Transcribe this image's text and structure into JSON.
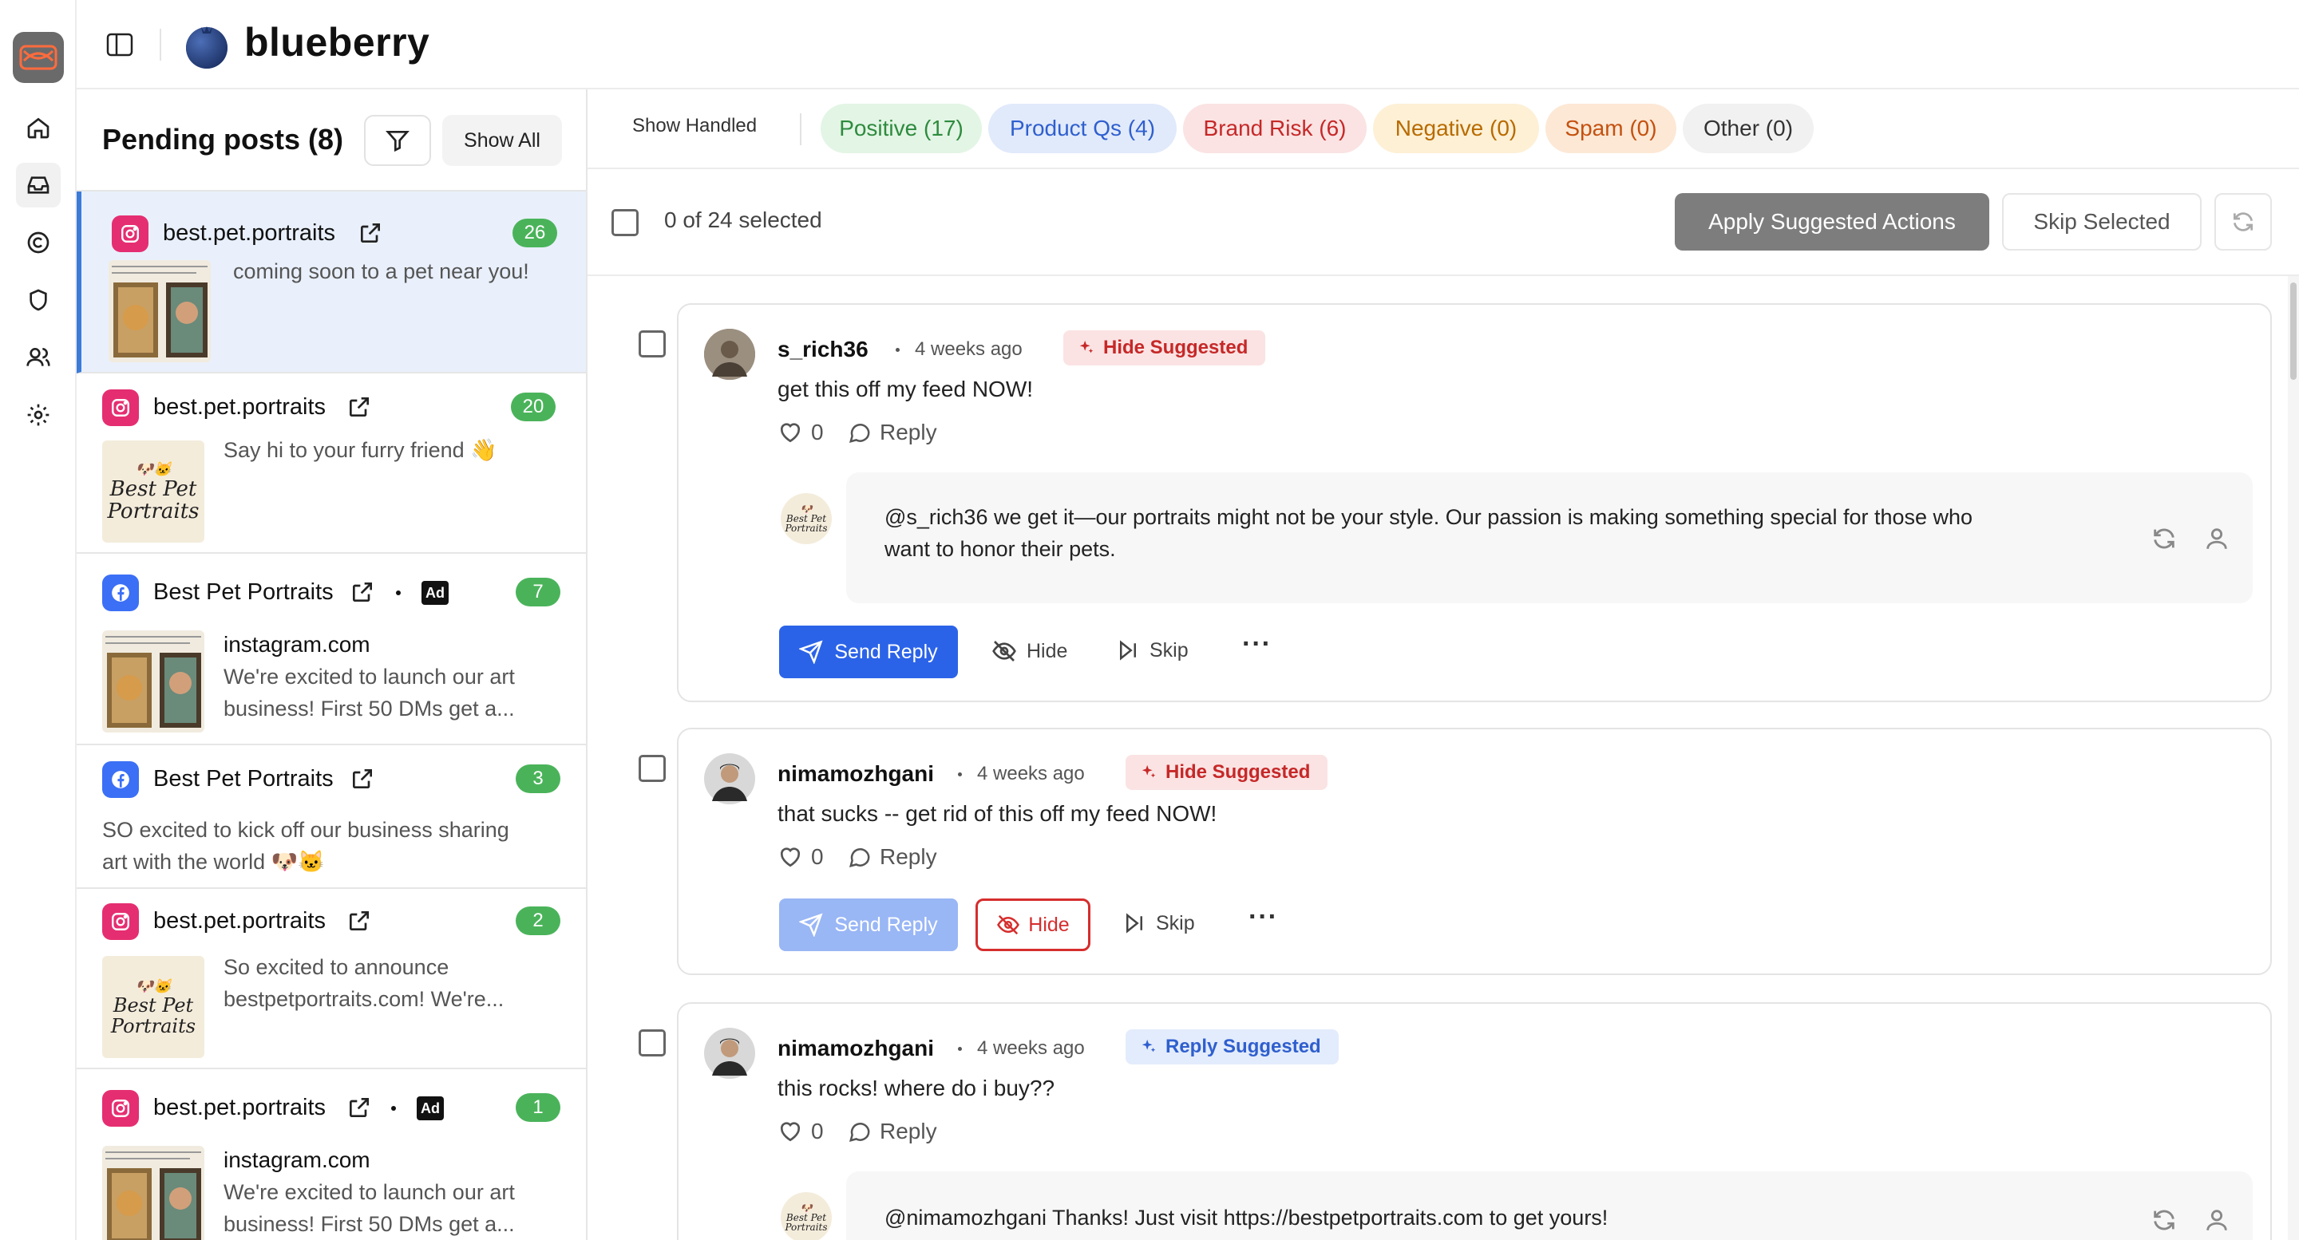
{
  "app": {
    "brand": "blueberry"
  },
  "rail": {
    "items": [
      "home",
      "inbox",
      "copyright",
      "shield",
      "users",
      "settings"
    ]
  },
  "posts_panel": {
    "title": "Pending posts (8)",
    "show_all_label": "Show All",
    "posts": [
      {
        "platform": "instagram",
        "name": "best.pet.portraits",
        "count": "26",
        "text": "coming soon to a pet near you!",
        "selected": true,
        "ad": false,
        "site": ""
      },
      {
        "platform": "instagram",
        "name": "best.pet.portraits",
        "count": "20",
        "text": "Say hi to your furry friend 👋",
        "selected": false,
        "ad": false,
        "site": ""
      },
      {
        "platform": "facebook",
        "name": "Best Pet Portraits",
        "count": "7",
        "site": "instagram.com",
        "text_line1": "We're excited to launch our art",
        "text_line2": "business! First 50 DMs get a...",
        "ad": true,
        "ad_label": "Ad"
      },
      {
        "platform": "facebook",
        "name": "Best Pet Portraits",
        "count": "3",
        "text_line1": "SO excited to kick off our business sharing",
        "text_line2": "art with the world 🐶🐱",
        "ad": false
      },
      {
        "platform": "instagram",
        "name": "best.pet.portraits",
        "count": "2",
        "text_line1": "So excited to announce",
        "text_line2": "bestpetportraits.com! We're...",
        "ad": false
      },
      {
        "platform": "instagram",
        "name": "best.pet.portraits",
        "count": "1",
        "site": "instagram.com",
        "text_line1": "We're excited to launch our art",
        "text_line2": "business! First 50 DMs get a...",
        "ad": true,
        "ad_label": "Ad"
      }
    ],
    "thumb_logo_line1": "Best Pet",
    "thumb_logo_line2": "Portraits"
  },
  "tabs": {
    "show_handled": "Show Handled",
    "chips": [
      {
        "label": "Positive (17)",
        "bg": "#e3f5e5",
        "fg": "#2e8b3e"
      },
      {
        "label": "Product Qs (4)",
        "bg": "#e1eafb",
        "fg": "#2f5fce"
      },
      {
        "label": "Brand Risk (6)",
        "bg": "#fbe3e3",
        "fg": "#c62828"
      },
      {
        "label": "Negative (0)",
        "bg": "#fdf0d5",
        "fg": "#b86b00"
      },
      {
        "label": "Spam (0)",
        "bg": "#fde8d6",
        "fg": "#c4510f"
      },
      {
        "label": "Other (0)",
        "bg": "#f1f1f1",
        "fg": "#333333"
      }
    ]
  },
  "selection": {
    "status": "0 of 24 selected",
    "apply_label": "Apply Suggested Actions",
    "skip_label": "Skip Selected"
  },
  "comments": [
    {
      "user": "s_rich36",
      "time": "4 weeks ago",
      "tag": "Hide Suggested",
      "tag_kind": "hide",
      "text": "get this off my feed NOW!",
      "likes": "0",
      "reply_label": "Reply",
      "draft_line1": "@s_rich36 we get it—our portraits might not be your style. Our passion is making something special for those who",
      "draft_line2": "want to honor their pets.",
      "send_label": "Send Reply",
      "hide_label": "Hide",
      "skip_label": "Skip"
    },
    {
      "user": "nimamozhgani",
      "time": "4 weeks ago",
      "tag": "Hide Suggested",
      "tag_kind": "hide",
      "text": "that sucks -- get rid of this off my feed NOW!",
      "likes": "0",
      "reply_label": "Reply",
      "send_label": "Send Reply",
      "hide_label": "Hide",
      "skip_label": "Skip"
    },
    {
      "user": "nimamozhgani",
      "time": "4 weeks ago",
      "tag": "Reply Suggested",
      "tag_kind": "reply",
      "text": "this rocks! where do i buy??",
      "likes": "0",
      "reply_label": "Reply",
      "draft_line1": "@nimamozhgani Thanks! Just visit https://bestpetportraits.com to get yours!"
    }
  ],
  "colors": {
    "accent": "#2b63e8",
    "selected_post_bg": "#e9f0fb",
    "count_badge": "#4ab35a",
    "instagram": "#e52e71",
    "facebook": "#3b6ff5"
  }
}
